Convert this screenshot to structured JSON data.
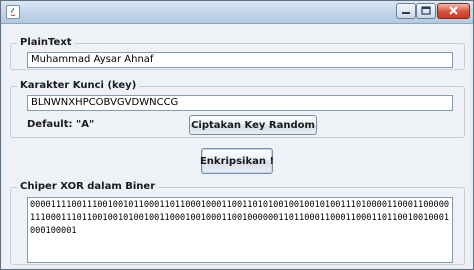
{
  "window": {
    "title": "",
    "icon": "java-app-icon",
    "controls": [
      "minimize-icon",
      "maximize-icon",
      "close-icon"
    ]
  },
  "plaintext": {
    "group_title": "PlainText",
    "value": "Muhammad Aysar Ahnaf"
  },
  "key": {
    "group_title": "Karakter Kunci (key)",
    "value": "BLNWNXHPCOBVGVDWNCCG",
    "default_label": "Default: \"A\"",
    "random_button_label": "Ciptakan Key Random"
  },
  "encrypt_button_label": "Enkripsikan !",
  "cipher": {
    "group_title": "Chiper XOR dalam Biner",
    "value": "000011110011100100101100011011000100011001101010010010010100111010000110001100000111000111011001001010010011000100100011001000000110110001100011000110110010010001000100001"
  }
}
